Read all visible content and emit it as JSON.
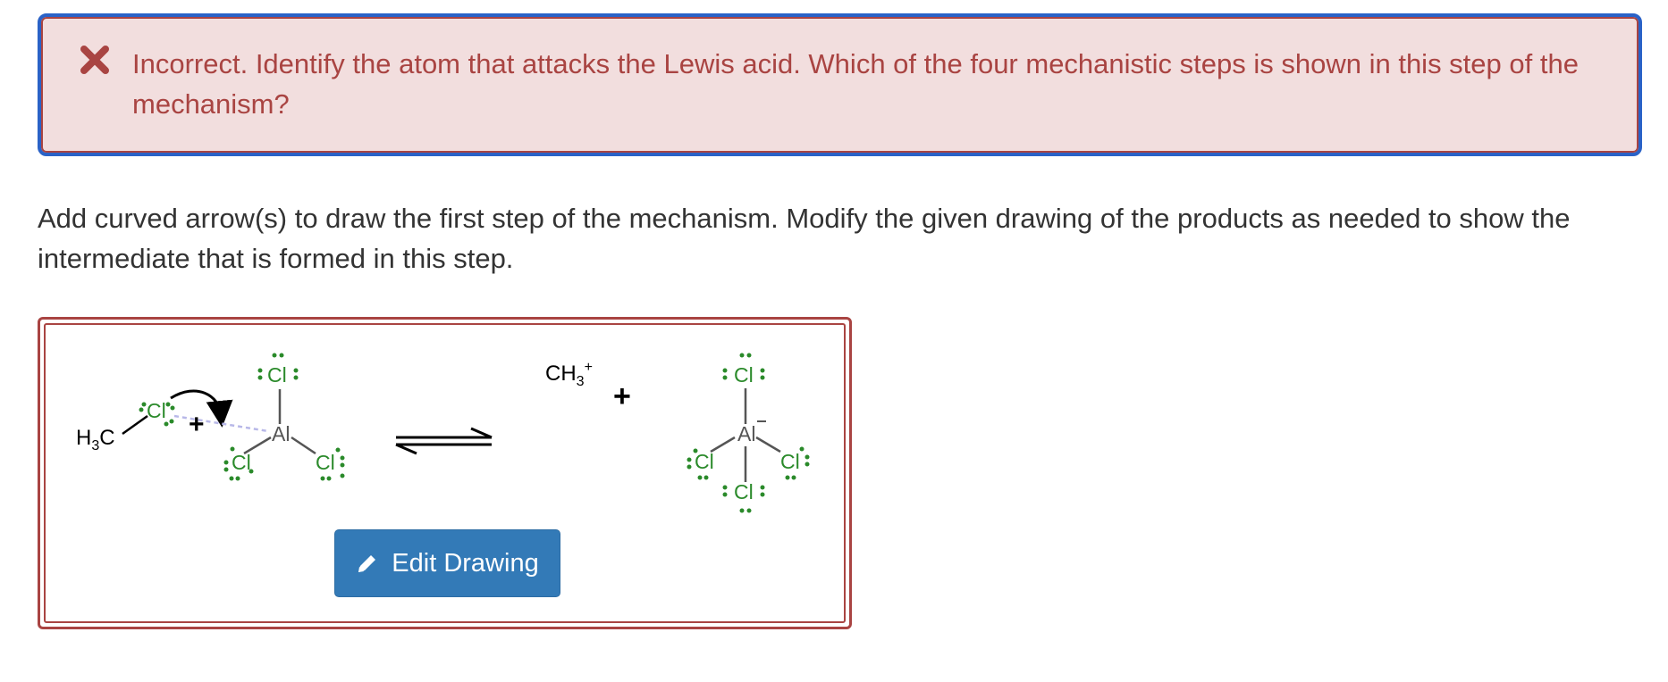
{
  "alert": {
    "icon": "close-icon",
    "message": "Incorrect. Identify the atom that attacks the Lewis acid. Which of the four mechanistic steps is shown in this step of the mechanism?",
    "text_color": "#a94442",
    "background": "#f2dede",
    "focus_color": "#2a62c7"
  },
  "prompt": {
    "text": "Add curved arrow(s) to draw the first step of the mechanism. Modify the given drawing of the products as needed to show the intermediate that is formed in this step."
  },
  "drawing": {
    "reactants": {
      "methyl_label": "H3C",
      "chlorine_label": "Cl",
      "aluminum_label": "Al",
      "plus_sign": "+"
    },
    "products": {
      "carbocation_label": "CH3+",
      "plus_sign": "+",
      "aluminum_label": "Al−"
    },
    "chlorine_color": "#2a8a2a",
    "edit_button_label": "Edit Drawing",
    "edit_button_icon": "pencil-icon",
    "button_color": "#337ab7"
  }
}
